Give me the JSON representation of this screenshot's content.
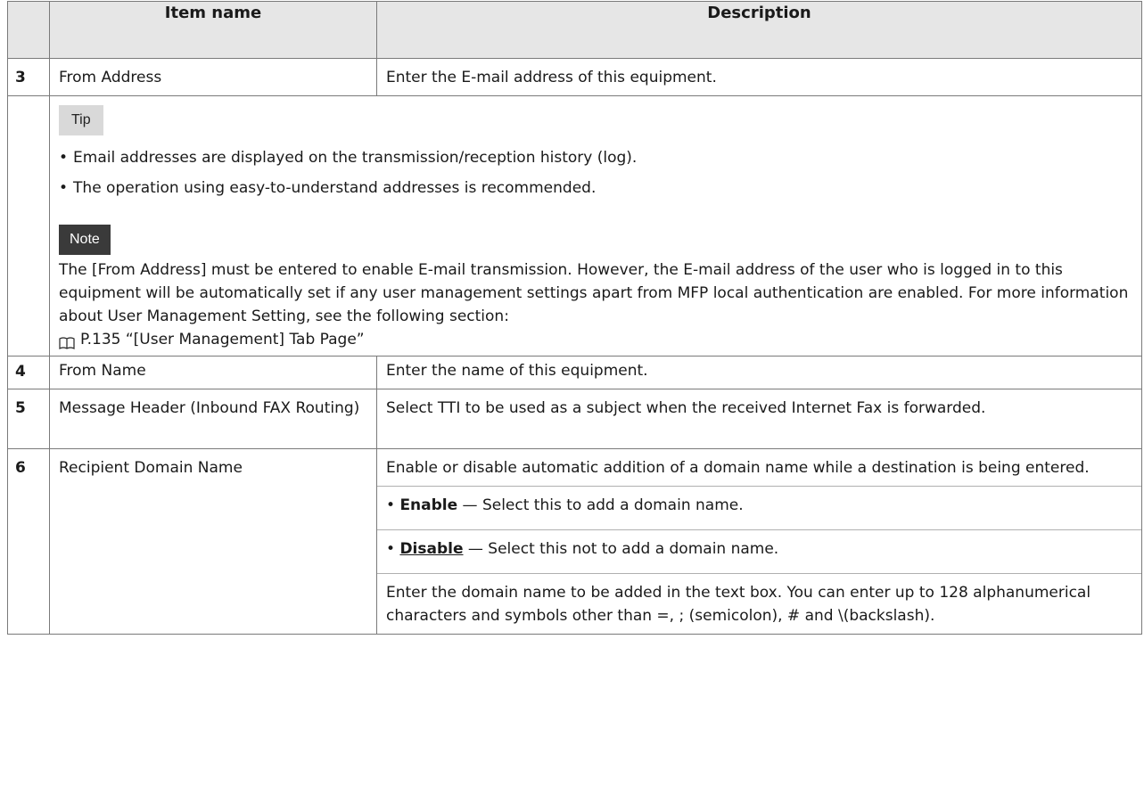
{
  "header": {
    "item_name": "Item name",
    "description": "Description"
  },
  "rows": {
    "r3": {
      "num": "3",
      "name": "From Address",
      "desc": "Enter the E-mail address of this equipment."
    },
    "r4": {
      "num": "4",
      "name": "From Name",
      "desc": "Enter the name of this equipment."
    },
    "r5": {
      "num": "5",
      "name": "Message Header (Inbound FAX Routing)",
      "desc": "Select TTI to be used as a subject when the received Internet Fax is forwarded."
    },
    "r6": {
      "num": "6",
      "name": "Recipient Domain Name",
      "desc": "Enable or disable automatic addition of a domain name while a destination is being entered.",
      "enable_label": "Enable",
      "enable_desc": " — Select this to add a domain name.",
      "disable_label": "Disable",
      "disable_desc": " — Select this not to add a domain name.",
      "extra": "Enter the domain name to be added in the text box. You can enter up to 128 alphanumerical characters and symbols other than =, ; (semicolon), # and \\(backslash)."
    }
  },
  "tip": {
    "label": "Tip",
    "items": [
      "Email addresses are displayed on the transmission/reception history (log).",
      "The operation using easy-to-understand addresses is recommended."
    ]
  },
  "note": {
    "label": "Note",
    "text": "The [From Address] must be entered to enable E-mail transmission. However, the E-mail address of the user who is logged in to this equipment will be automatically set if any user management settings apart from MFP local authentication are enabled. For more information about User Management Setting, see the following section:",
    "reference": "P.135 “[User Management] Tab Page”"
  }
}
